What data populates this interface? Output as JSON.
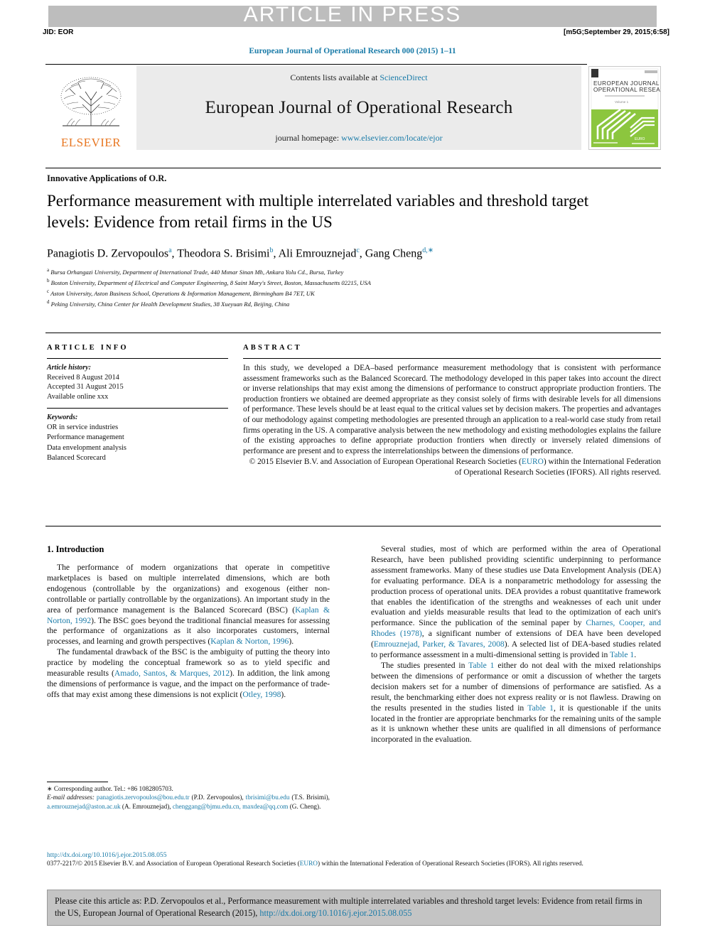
{
  "header": {
    "article_in_press": "ARTICLE IN PRESS",
    "jid": "JID: EOR",
    "stamp": "[m5G;September 29, 2015;6:58]",
    "running_head": "European Journal of Operational Research 000 (2015) 1–11"
  },
  "masthead": {
    "contents_prefix": "Contents lists available at ",
    "contents_link": "ScienceDirect",
    "journal_name": "European Journal of Operational Research",
    "homepage_prefix": "journal homepage: ",
    "homepage_url": "www.elsevier.com/locate/ejor",
    "publisher": "ELSEVIER",
    "cover_title_line1": "EUROPEAN JOURNAL OF",
    "cover_title_line2": "OPERATIONAL RESEARCH",
    "cover_volume": "Volume 1",
    "cover_footer": "EURO"
  },
  "article": {
    "section_kind": "Innovative Applications of O.R.",
    "title": "Performance measurement with multiple interrelated variables and threshold target levels: Evidence from retail firms in the US",
    "authors_html": "Panagiotis D. Zervopoulos<sup>a</sup>, Theodora S. Brisimi<sup>b</sup>, Ali Emrouznejad<sup>c</sup>, Gang Cheng<sup>d,</sup><sup class=\"star\">∗</sup>",
    "affiliations": [
      {
        "mark": "a",
        "text": "Bursa Orhangazi University, Department of International Trade, 440 Mımar Sinan Mh, Ankara Yolu Cd., Bursa, Turkey"
      },
      {
        "mark": "b",
        "text": "Boston University, Department of Electrical and Computer Engineering, 8 Saint Mary's Street, Boston, Massachusetts 02215, USA"
      },
      {
        "mark": "c",
        "text": "Aston University, Aston Business School, Operations & Information Management, Birmingham B4 7ET, UK"
      },
      {
        "mark": "d",
        "text": "Peking University, China Center for Health Development Studies, 38 Xueyuan Rd, Beijing, China"
      }
    ]
  },
  "info": {
    "label": "ARTICLE INFO",
    "history_label": "Article history:",
    "history": [
      "Received 8 August 2014",
      "Accepted 31 August 2015",
      "Available online xxx"
    ],
    "keywords_label": "Keywords:",
    "keywords": [
      "OR in service industries",
      "Performance management",
      "Data envelopment analysis",
      "Balanced Scorecard"
    ]
  },
  "abstract": {
    "label": "ABSTRACT",
    "text": "In this study, we developed a DEA–based performance measurement methodology that is consistent with performance assessment frameworks such as the Balanced Scorecard. The methodology developed in this paper takes into account the direct or inverse relationships that may exist among the dimensions of performance to construct appropriate production frontiers. The production frontiers we obtained are deemed appropriate as they consist solely of firms with desirable levels for all dimensions of performance. These levels should be at least equal to the critical values set by decision makers. The properties and advantages of our methodology against competing methodologies are presented through an application to a real-world case study from retail firms operating in the US. A comparative analysis between the new methodology and existing methodologies explains the failure of the existing approaches to define appropriate production frontiers when directly or inversely related dimensions of performance are present and to express the interrelationships between the dimensions of performance.",
    "copyright_pre": "© 2015 Elsevier B.V. and Association of European Operational Research Societies (",
    "copyright_link": "EURO",
    "copyright_post": ") within the International Federation of Operational Research Societies (IFORS). All rights reserved."
  },
  "body": {
    "intro_heading": "1. Introduction",
    "left_paragraphs": [
      {
        "parts": [
          {
            "t": "The performance of modern organizations that operate in competitive marketplaces is based on multiple interrelated dimensions, which are both endogenous (controllable by the organizations) and exogenous (either non-controllable or partially controllable by the organizations). An important study in the area of performance management is the Balanced Scorecard (BSC) ("
          },
          {
            "t": "Kaplan & Norton, 1992",
            "link": true
          },
          {
            "t": "). The BSC goes beyond the traditional financial measures for assessing the performance of organizations as it also incorporates customers, internal processes, and learning and growth perspectives ("
          },
          {
            "t": "Kaplan & Norton, 1996",
            "link": true
          },
          {
            "t": ")."
          }
        ]
      },
      {
        "parts": [
          {
            "t": "The fundamental drawback of the BSC is the ambiguity of putting the theory into practice by modeling the conceptual framework so as to yield specific and measurable results ("
          },
          {
            "t": "Amado, Santos, & Marques, 2012",
            "link": true
          },
          {
            "t": "). In addition, the link among the dimensions of performance is vague, and the impact on the performance of trade-offs that may exist among these dimensions is not explicit ("
          },
          {
            "t": "Otley, 1998",
            "link": true
          },
          {
            "t": ")."
          }
        ]
      }
    ],
    "right_paragraphs": [
      {
        "parts": [
          {
            "t": "Several studies, most of which are performed within the area of Operational Research, have been published providing scientific underpinning to performance assessment frameworks. Many of these studies use Data Envelopment Analysis (DEA) for evaluating performance. DEA is a nonparametric methodology for assessing the production process of operational units. DEA provides a robust quantitative framework that enables the identification of the strengths and weaknesses of each unit under evaluation and yields measurable results that lead to the optimization of each unit's performance. Since the publication of the seminal paper by "
          },
          {
            "t": "Charnes, Cooper, and Rhodes (1978)",
            "link": true
          },
          {
            "t": ", a significant number of extensions of DEA have been developed ("
          },
          {
            "t": "Emrouznejad, Parker, & Tavares, 2008",
            "link": true
          },
          {
            "t": "). A selected list of DEA-based studies related to performance assessment in a multi-dimensional setting is provided in "
          },
          {
            "t": "Table 1",
            "link": true
          },
          {
            "t": "."
          }
        ]
      },
      {
        "parts": [
          {
            "t": "The studies presented in "
          },
          {
            "t": "Table 1",
            "link": true
          },
          {
            "t": " either do not deal with the mixed relationships between the dimensions of performance or omit a discussion of whether the targets decision makers set for a number of dimensions of performance are satisfied. As a result, the benchmarking either does not express reality or is not flawless. Drawing on the results presented in the studies listed in "
          },
          {
            "t": "Table 1",
            "link": true
          },
          {
            "t": ", it is questionable if the units located in the frontier are appropriate benchmarks for the remaining units of the sample as it is unknown whether these units are qualified in all dimensions of performance incorporated in the evaluation."
          }
        ]
      }
    ]
  },
  "footnote": {
    "corresponding": "Corresponding author. Tel.: +86 1082805703.",
    "email_label": "E-mail addresses:",
    "emails": [
      {
        "addr": "panagiotis.zervopoulos@bou.edu.tr",
        "who": "(P.D. Zervopoulos),"
      },
      {
        "addr": "tbrisimi@bu.edu",
        "who": "(T.S. Brisimi),"
      },
      {
        "addr": "a.emrouznejad@aston.ac.uk",
        "who": "(A. Emrouznejad),"
      },
      {
        "addr": "chenggang@bjmu.edu.cn, maxdea@qq.com",
        "who": "(G. Cheng)."
      }
    ]
  },
  "footer": {
    "doi": "http://dx.doi.org/10.1016/j.ejor.2015.08.055",
    "issn_pre": "0377-2217/© 2015 Elsevier B.V. and Association of European Operational Research Societies (",
    "issn_link": "EURO",
    "issn_post": ") within the International Federation of Operational Research Societies (IFORS). All rights reserved.",
    "cite_pre": "Please cite this article as: P.D. Zervopoulos et al., Performance measurement with multiple interrelated variables and threshold target levels: Evidence from retail firms in the US, European Journal of Operational Research (2015), ",
    "cite_link": "http://dx.doi.org/10.1016/j.ejor.2015.08.055"
  },
  "colors": {
    "link": "#1a7ba8",
    "band": "#bdbdbd",
    "masthead_bg": "#ebebeb",
    "elsevier_orange": "#e87722",
    "cover_green": "#8cc63e",
    "cite_box_bg": "#c4c4c4"
  }
}
